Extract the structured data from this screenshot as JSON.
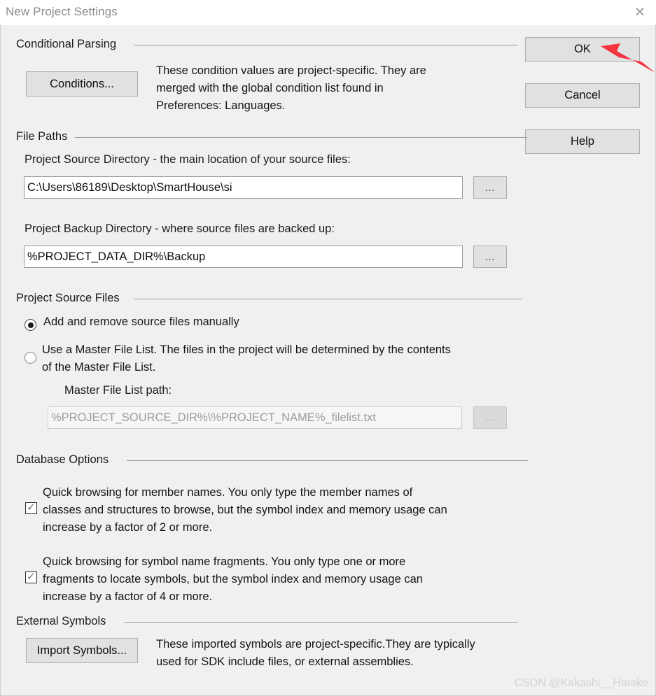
{
  "window": {
    "title": "New Project Settings",
    "close_icon": "close-icon"
  },
  "buttons": {
    "ok": "OK",
    "cancel": "Cancel",
    "help": "Help",
    "conditions": "Conditions...",
    "import_symbols": "Import Symbols...",
    "browse": "..."
  },
  "groups": {
    "conditional_parsing": "Conditional Parsing",
    "file_paths": "File Paths",
    "project_source_files": "Project Source Files",
    "database_options": "Database Options",
    "external_symbols": "External Symbols"
  },
  "conditional_parsing": {
    "description_line1": "These condition values are project-specific.  They are",
    "description_line2": "merged with the global condition list found in",
    "description_line3": "Preferences: Languages."
  },
  "file_paths": {
    "source_label": "Project Source Directory - the main location of your source files:",
    "source_value": "C:\\Users\\86189\\Desktop\\SmartHouse\\si",
    "backup_label": "Project Backup Directory - where source files are backed up:",
    "backup_value": "%PROJECT_DATA_DIR%\\Backup"
  },
  "project_source_files": {
    "radio_manual": "Add and remove source files manually",
    "radio_master_line1": "Use a Master File List. The files in the project will be determined by the contents",
    "radio_master_line2": "of the Master File List.",
    "master_path_label": "Master File List path:",
    "master_path_value": "%PROJECT_SOURCE_DIR%\\%PROJECT_NAME%_filelist.txt",
    "selected": "manual"
  },
  "database_options": {
    "option1_line1": "Quick browsing for member names.  You only type the member names of",
    "option1_line2": "classes and structures to browse, but the symbol index and memory usage can",
    "option1_line3": "increase by a factor of 2 or more.",
    "option1_checked": true,
    "option2_line1": "Quick browsing for symbol name fragments.  You only type one or more",
    "option2_line2": "fragments to locate symbols, but the symbol index and memory usage can",
    "option2_line3": "increase by a factor of 4 or more.",
    "option2_checked": true,
    "check_glyph": "✓"
  },
  "external_symbols": {
    "description_line1": "These imported symbols are project-specific.They are typically",
    "description_line2": "used for SDK include files, or external assemblies."
  },
  "annotation": {
    "arrow_color": "#f5333f"
  },
  "watermark": {
    "text": "CSDN @Kakashi__Hatake"
  },
  "colors": {
    "dialog_background": "#f0f0f0",
    "titlebar_background": "#ffffff",
    "button_face": "#e1e1e1",
    "group_line": "#9a9a9a",
    "text": "#1a1a1a"
  }
}
